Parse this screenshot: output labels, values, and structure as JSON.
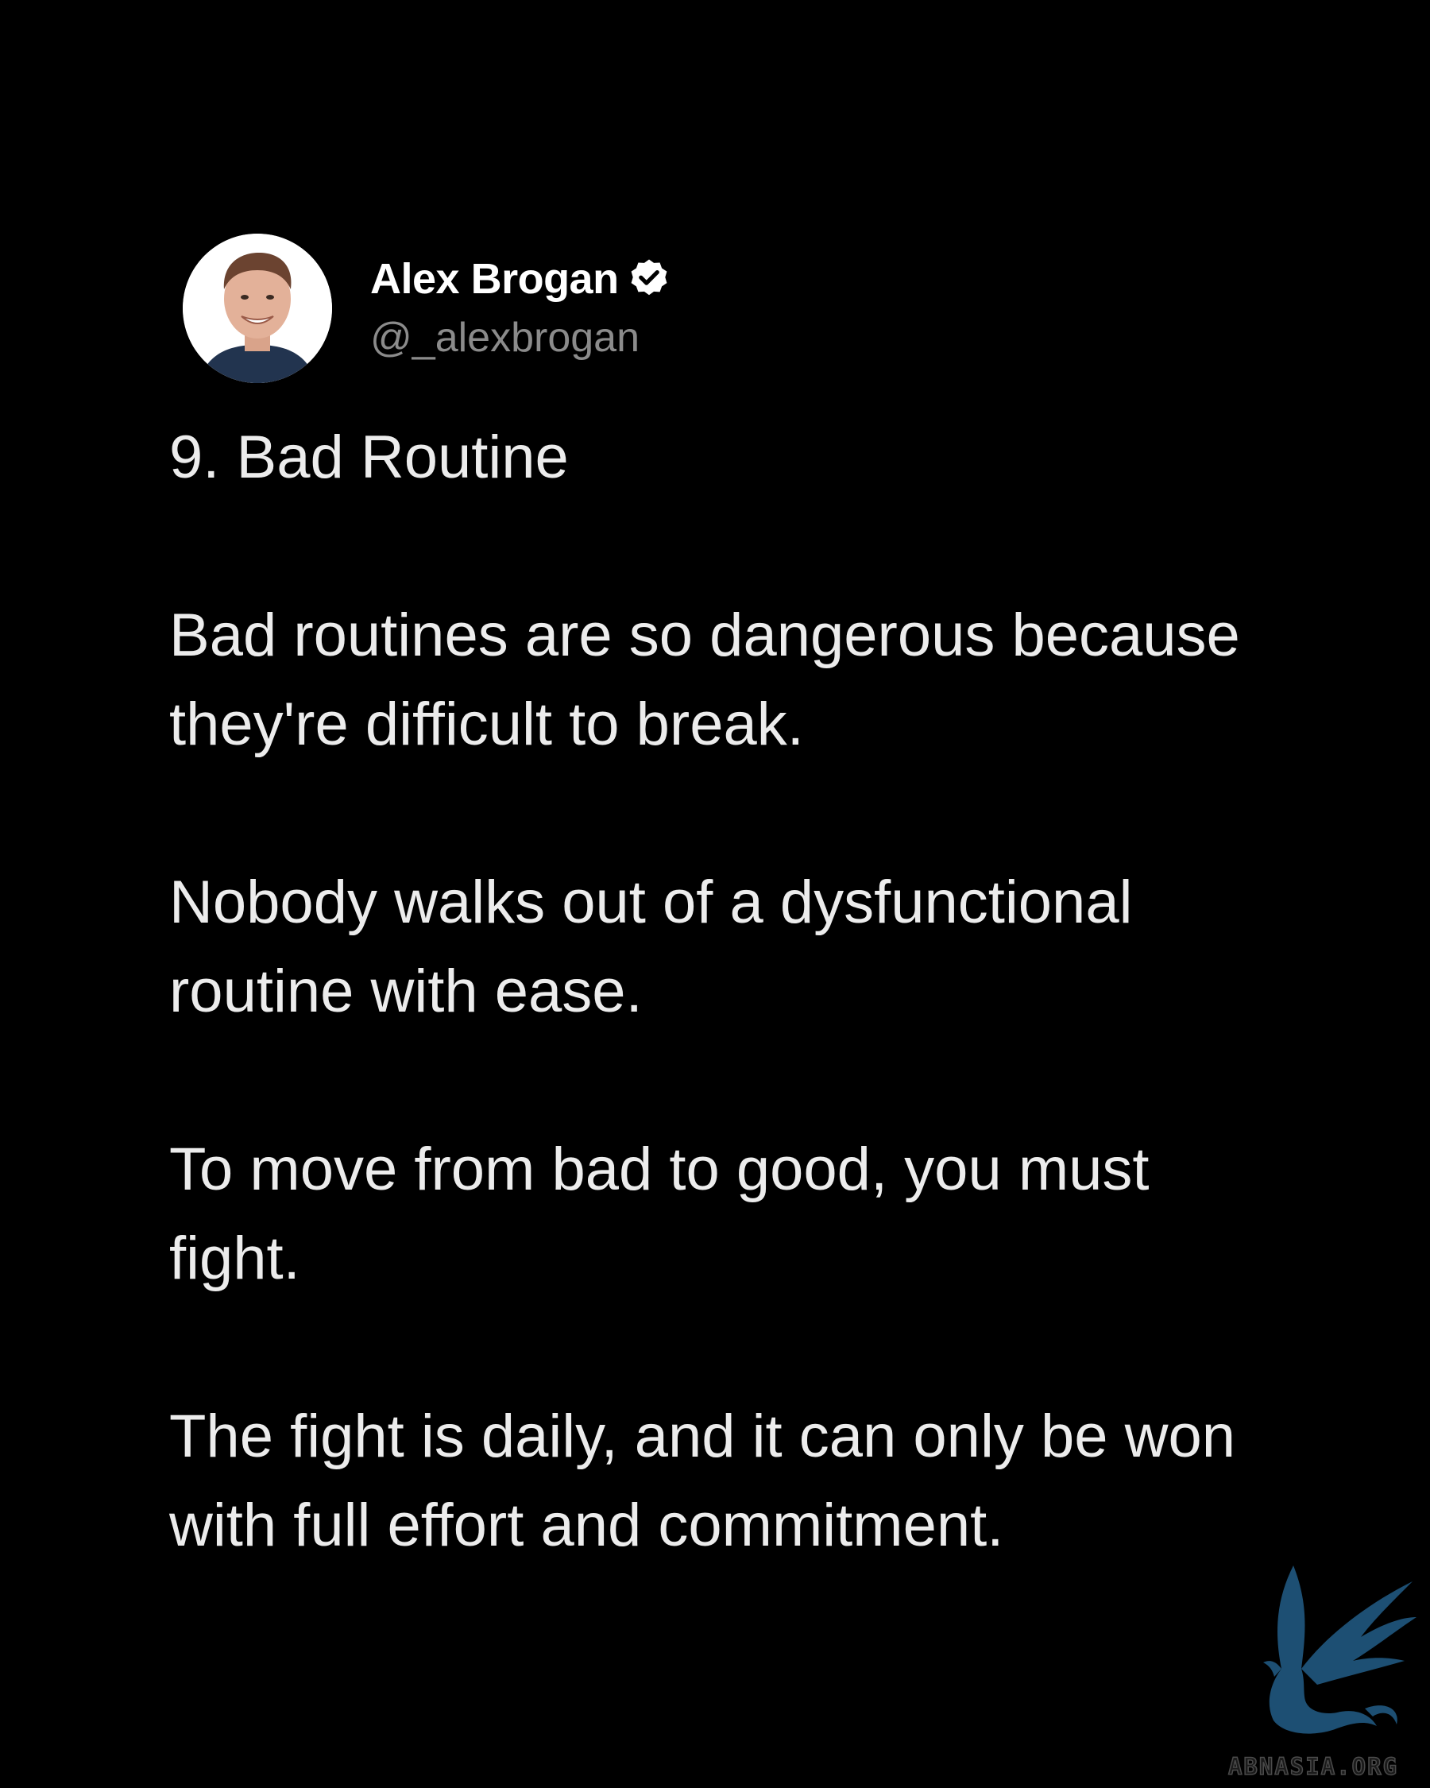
{
  "author": {
    "display_name": "Alex Brogan",
    "handle": "@_alexbrogan",
    "verified_icon": "verified-badge-icon",
    "avatar_icon": "profile-photo"
  },
  "post": {
    "paragraphs": [
      "9. Bad Routine",
      "Bad routines are so dangerous because they're difficult to break.",
      "Nobody walks out of a dysfunctional routine with ease.",
      "To move from bad to good, you must fight.",
      "The fight is daily, and it can only be won with full effort and commitment."
    ]
  },
  "watermark": {
    "text": "ABNASIA.ORG",
    "icon": "griffin-logo",
    "color": "#1d4f73"
  },
  "colors": {
    "background": "#000000",
    "text": "#ececec",
    "handle": "#8b8b8b"
  }
}
